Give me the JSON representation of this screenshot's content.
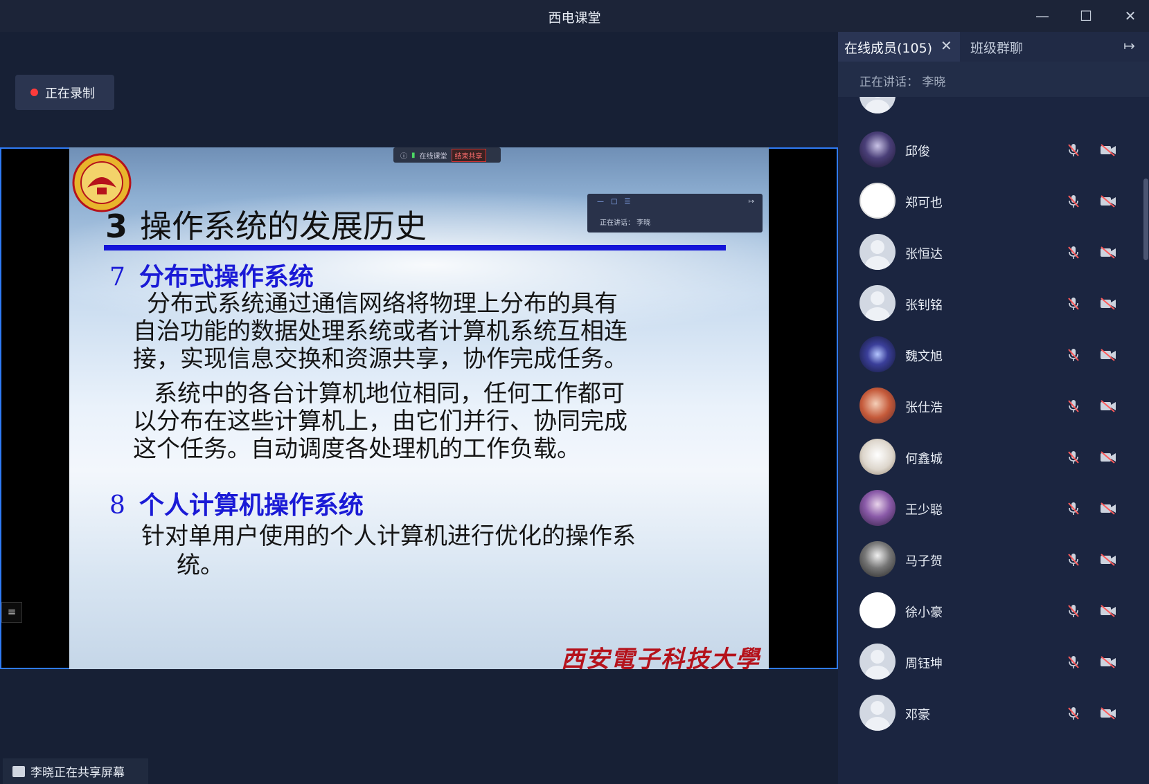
{
  "window": {
    "title": "西电课堂"
  },
  "recording": {
    "label": "正在录制"
  },
  "shared_slide": {
    "mini_toolbar": {
      "app": "在线课堂",
      "end_label": "结束共享"
    },
    "mini_panel": {
      "speaking": "正在讲话：  李晓"
    },
    "title_num": "3",
    "title": "操作系统的发展历史",
    "section7": {
      "num": "7",
      "heading": "分布式操作系统"
    },
    "para1": [
      "分布式系统通过通信网络将物理上分布的具有",
      "自治功能的数据处理系统或者计算机系统互相连",
      "接，实现信息交换和资源共享，协作完成任务。"
    ],
    "para2": [
      "系统中的各台计算机地位相同，任何工作都可",
      "以分布在这些计算机上，由它们并行、协同完成",
      "这个任务。自动调度各处理机的工作负载。"
    ],
    "section8": {
      "num": "8",
      "heading": "个人计算机操作系统"
    },
    "para3": [
      "针对单用户使用的个人计算机进行优化的操作系",
      "统。"
    ],
    "university": "西安電子科技大學"
  },
  "share_notice": "李晓正在共享屏幕",
  "panel": {
    "tab_members": "在线成员(105)",
    "tab_chat": "班级群聊",
    "speaking": "正在讲话：  李晓",
    "members": [
      {
        "name": "邱俊",
        "avatar": "photo-dark"
      },
      {
        "name": "郑可也",
        "avatar": "cartoon-white"
      },
      {
        "name": "张恒达",
        "avatar": "default"
      },
      {
        "name": "张钊铭",
        "avatar": "default"
      },
      {
        "name": "魏文旭",
        "avatar": "photo-galaxy"
      },
      {
        "name": "张仕浩",
        "avatar": "photo-anime"
      },
      {
        "name": "何鑫城",
        "avatar": "photo-dog"
      },
      {
        "name": "王少聪",
        "avatar": "photo-purple"
      },
      {
        "name": "马子贺",
        "avatar": "photo-bw"
      },
      {
        "name": "徐小豪",
        "avatar": "white"
      },
      {
        "name": "周钰坤",
        "avatar": "default"
      },
      {
        "name": "邓豪",
        "avatar": "default"
      }
    ]
  },
  "colors": {
    "accent": "#2f7bf5",
    "record_dot": "#ff3b3b",
    "slide_heading": "#1a1ad6",
    "slide_rule": "#1414d8",
    "university": "#b5121b"
  }
}
